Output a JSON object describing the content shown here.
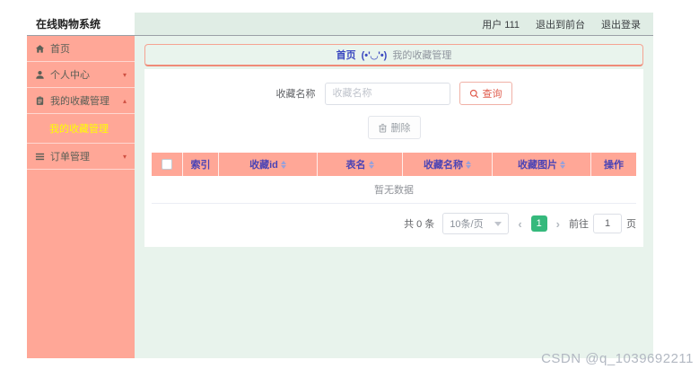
{
  "header": {
    "title": "在线购物系统",
    "user_label": "用户 111",
    "exit_front_label": "退出到前台",
    "logout_label": "退出登录"
  },
  "sidebar": {
    "items": [
      {
        "label": "首页",
        "icon": "home-icon"
      },
      {
        "label": "个人中心",
        "icon": "user-icon",
        "chevron": "▾"
      },
      {
        "label": "我的收藏管理",
        "icon": "clipboard-icon",
        "chevron": "▴"
      },
      {
        "label": "我的收藏管理",
        "type": "submenu",
        "active": true
      },
      {
        "label": "订单管理",
        "icon": "menu-icon",
        "chevron": "▾"
      }
    ]
  },
  "breadcrumb": {
    "home": "首页",
    "separator": "(•'◡'•)",
    "current": "我的收藏管理"
  },
  "search": {
    "label": "收藏名称",
    "placeholder": "收藏名称",
    "value": "",
    "query_button": "查询"
  },
  "toolbar": {
    "delete_button": "删除"
  },
  "table": {
    "columns": [
      {
        "label": "索引",
        "sortable": false
      },
      {
        "label": "收藏id",
        "sortable": true
      },
      {
        "label": "表名",
        "sortable": true
      },
      {
        "label": "收藏名称",
        "sortable": true
      },
      {
        "label": "收藏图片",
        "sortable": true
      },
      {
        "label": "操作",
        "sortable": false
      }
    ],
    "rows": [],
    "empty_text": "暂无数据"
  },
  "pagination": {
    "total_label": "共 0 条",
    "page_size_label": "10条/页",
    "prev": "‹",
    "current_page": "1",
    "next": "›",
    "goto_prefix": "前往",
    "goto_value": "1",
    "goto_suffix": "页"
  },
  "watermark": "CSDN @q_1039692211",
  "colors": {
    "sidebar_bg": "#ffa797",
    "table_header_bg": "#ffa797",
    "header_bar_bg": "#e0ede5",
    "content_bg": "#e8f3ec",
    "breadcrumb_border": "#f5a392",
    "breadcrumb_link": "#3b49c0",
    "active_page_green": "#35b97c",
    "query_button_red": "#e05c4d",
    "submenu_active_yellow": "#ffff00"
  }
}
